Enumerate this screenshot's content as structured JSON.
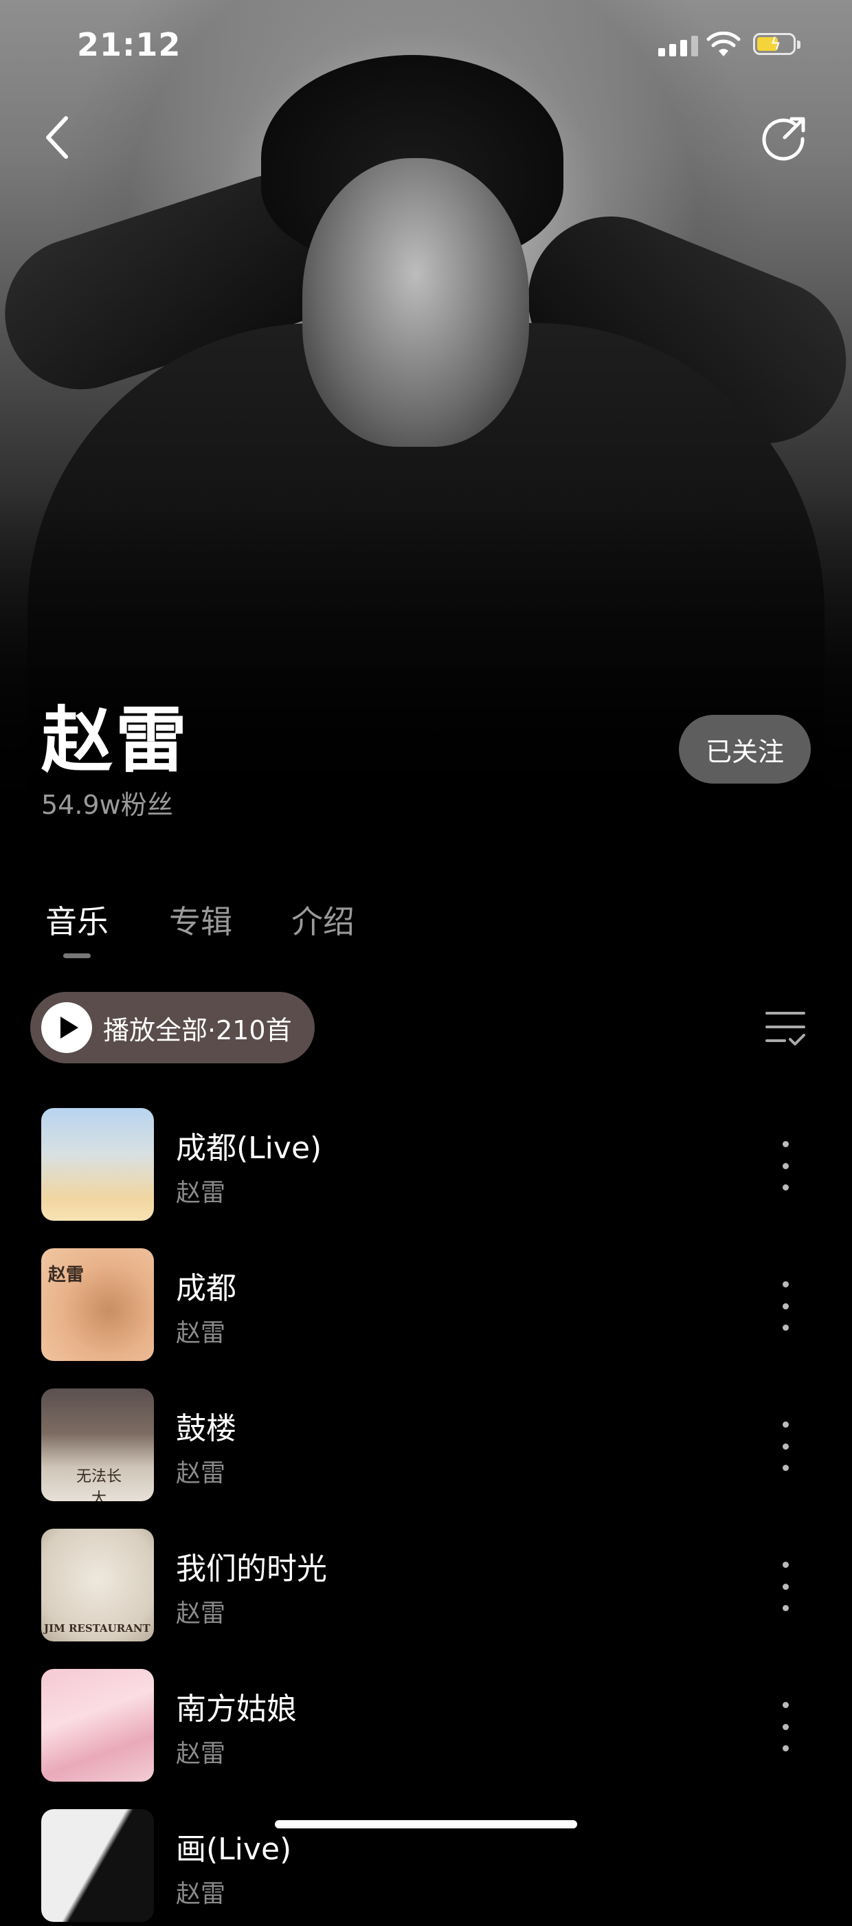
{
  "status_bar": {
    "time": "21:12"
  },
  "header": {
    "back_icon": "chevron-left-icon",
    "share_icon": "share-icon"
  },
  "artist": {
    "name": "赵雷",
    "fans": "54.9w粉丝",
    "follow_label": "已关注"
  },
  "tabs": [
    {
      "label": "音乐",
      "active": true
    },
    {
      "label": "专辑",
      "active": false
    },
    {
      "label": "介绍",
      "active": false
    }
  ],
  "toolbar": {
    "play_all_label": "播放全部·210首",
    "manage_icon": "list-manage-icon"
  },
  "songs": [
    {
      "title": "成都(Live)",
      "artist": "赵雷"
    },
    {
      "title": "成都",
      "artist": "赵雷",
      "cover_text": "赵雷"
    },
    {
      "title": "鼓楼",
      "artist": "赵雷",
      "cover_text": "无法长大"
    },
    {
      "title": "我们的时光",
      "artist": "赵雷",
      "cover_text": "JIM RESTAURANT"
    },
    {
      "title": "南方姑娘",
      "artist": "赵雷"
    },
    {
      "title": "画(Live)",
      "artist": "赵雷"
    }
  ],
  "colors": {
    "accent_play_pill": "#5a4d4b",
    "follow_button": "#6e6e6e",
    "battery": "#f5d33a"
  }
}
